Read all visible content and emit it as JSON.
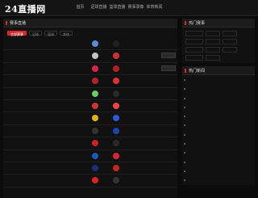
{
  "site": {
    "logo": "24直播网"
  },
  "nav": [
    "首页",
    "足球直播",
    "篮球直播",
    "赛事录像",
    "体育新闻"
  ],
  "schedule": {
    "title": "赛事直播",
    "filters": [
      "全部赛事",
      "足球",
      "篮球",
      "其他"
    ],
    "rows": [
      {
        "time": "",
        "league": "",
        "home": "",
        "away": "",
        "home_color": "#5a8cd8",
        "away_color": "#222",
        "btn": ""
      },
      {
        "time": "",
        "league": "",
        "home": "",
        "away": "",
        "home_color": "#c3c3c3",
        "away_color": "#c33",
        "btn": ""
      },
      {
        "time": "",
        "league": "",
        "home": "",
        "away": "",
        "home_color": "#d24",
        "away_color": "#a22",
        "btn": ""
      },
      {
        "time": "",
        "league": "",
        "home": "",
        "away": "",
        "home_color": "#b3212c",
        "away_color": "#d33",
        "btn": ""
      },
      {
        "time": "",
        "league": "",
        "home": "",
        "away": "",
        "home_color": "#6c6",
        "away_color": "#2a2a2a",
        "btn": ""
      },
      {
        "time": "",
        "league": "",
        "home": "",
        "away": "",
        "home_color": "#c33",
        "away_color": "#e44",
        "btn": ""
      },
      {
        "time": "",
        "league": "",
        "home": "",
        "away": "",
        "home_color": "#e2b21a",
        "away_color": "#2a5ad4",
        "btn": ""
      },
      {
        "time": "",
        "league": "",
        "home": "",
        "away": "",
        "home_color": "#333",
        "away_color": "#2244aa",
        "btn": ""
      },
      {
        "time": "",
        "league": "",
        "home": "",
        "away": "",
        "home_color": "#c22",
        "away_color": "#2a2a2a",
        "btn": ""
      },
      {
        "time": "",
        "league": "",
        "home": "",
        "away": "",
        "home_color": "#1e56b8",
        "away_color": "#d23",
        "btn": ""
      },
      {
        "time": "",
        "league": "",
        "home": "",
        "away": "",
        "home_color": "#1a2f7a",
        "away_color": "#c22",
        "btn": ""
      },
      {
        "time": "",
        "league": "",
        "home": "",
        "away": "",
        "home_color": "#d22",
        "away_color": "#333",
        "btn": ""
      }
    ]
  },
  "hot": {
    "title": "热门赛事",
    "tags": [
      "",
      "",
      "",
      "",
      "",
      "",
      "",
      "",
      "",
      "",
      ""
    ]
  },
  "news": {
    "title": "热门新闻",
    "items": [
      "",
      "",
      "",
      "",
      "",
      "",
      "",
      "",
      "",
      "",
      "",
      ""
    ]
  }
}
